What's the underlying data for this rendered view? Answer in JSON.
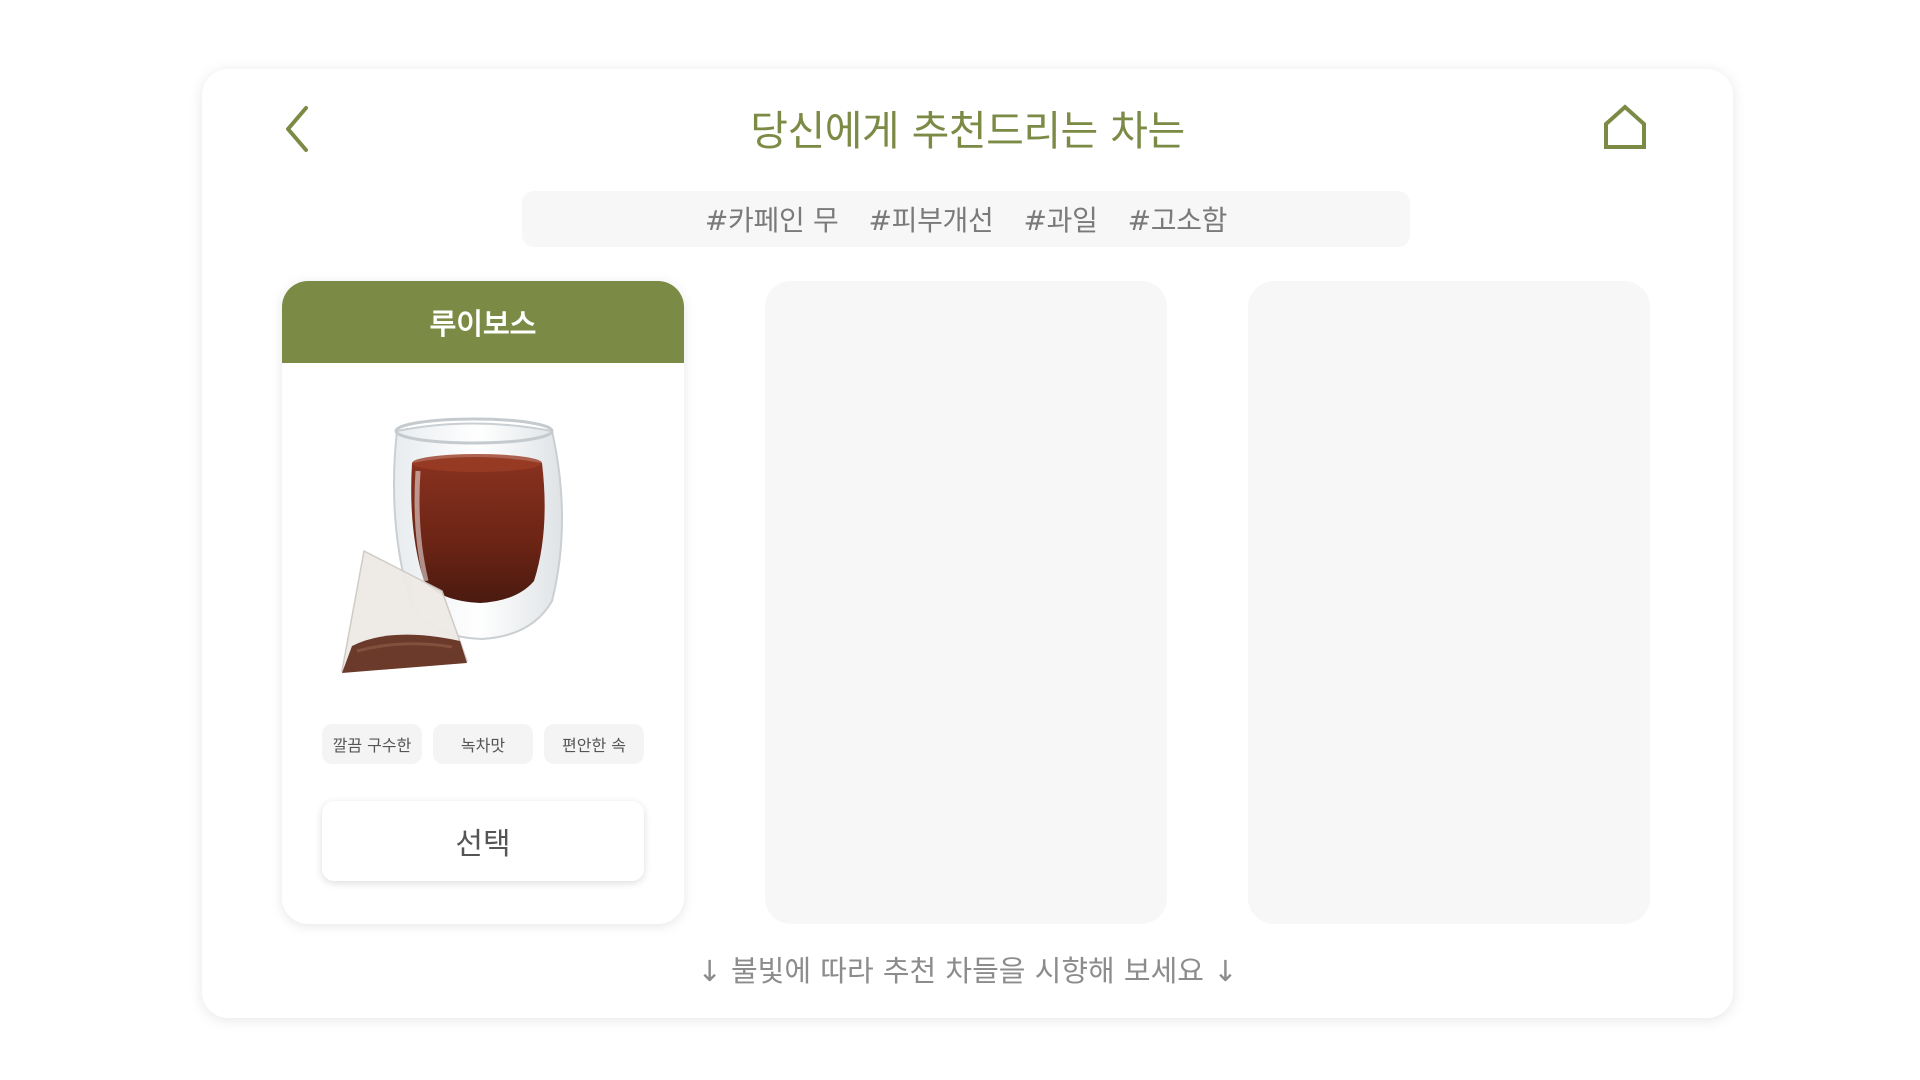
{
  "header": {
    "title": "당신에게 추천드리는 차는"
  },
  "tags": [
    "#카페인 무",
    "#피부개선",
    "#과일",
    "#고소함"
  ],
  "cards": [
    {
      "name": "루이보스",
      "chips": [
        "깔끔 구수한",
        "녹차맛",
        "편안한 속"
      ],
      "select_label": "선택"
    }
  ],
  "hint": "↓ 불빛에 따라 추천 차들을 시향해 보세요 ↓",
  "colors": {
    "accent": "#7b8a45",
    "placeholder_card": "#f7f7f7",
    "tea_liquid": "#7a2a18"
  },
  "icons": {
    "back": "chevron-left-icon",
    "home": "home-icon"
  }
}
